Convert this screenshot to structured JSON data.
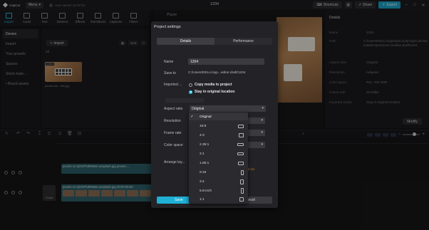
{
  "app": {
    "logo_text": "CapCut",
    "menu_label": "Menu",
    "autosave_text": "Auto saved: 21:07:51",
    "project_title": "1204",
    "shortcuts_label": "Shortcuts",
    "share_label": "Share",
    "export_label": "Export",
    "minimize_glyph": "–",
    "maximize_glyph": "□",
    "close_glyph": "✕"
  },
  "tools": [
    {
      "label": "Import",
      "icon": "import-icon"
    },
    {
      "label": "Audio",
      "icon": "audio-icon"
    },
    {
      "label": "Text",
      "icon": "text-icon"
    },
    {
      "label": "Stickers",
      "icon": "stickers-icon"
    },
    {
      "label": "Effects",
      "icon": "effects-icon"
    },
    {
      "label": "Transitions",
      "icon": "transitions-icon"
    },
    {
      "label": "Captions",
      "icon": "captions-icon"
    },
    {
      "label": "Filters",
      "icon": "filters-icon"
    }
  ],
  "left_nav": {
    "items": [
      "Device",
      "Import",
      "Your presets",
      "Spaces",
      "Stock mate...",
      "• Brand assets"
    ]
  },
  "media": {
    "import_label": "Import",
    "sort_label": "Sort",
    "all_label": "All",
    "added_badge": "Added",
    "thumb_name": "pexels-ckl... flat.jpg"
  },
  "player": {
    "title": "Player"
  },
  "details_panel": {
    "title": "Details",
    "rows": [
      {
        "key": "Name",
        "value": "1204"
      },
      {
        "key": "Path",
        "value": "C:/Users/DELL/AppData/Local/CapCut/User Data/Projects/com.lveditor.draft/1204"
      },
      {
        "key": "Aspect ratio",
        "value": "Original"
      },
      {
        "key": "Resolution",
        "value": "Adapted"
      },
      {
        "key": "Color space",
        "value": "Rec. 709 SDR"
      },
      {
        "key": "Frame rate",
        "value": "30.00fps"
      },
      {
        "key": "Imported media",
        "value": "Stay in original location"
      }
    ],
    "modify_label": "Modify"
  },
  "timeline": {
    "clip_a_label": "pexels-cs-QHOPhdR6Mw-unsplash.jpg  pexels-...",
    "clip_b_label": "pexels-cs-QHOPhdR6Mw-unsplash.jpg  00:00:05:00",
    "cover_label": "Cover"
  },
  "modal": {
    "title": "Project settings",
    "tab_details": "Details",
    "tab_performance": "Performance",
    "name_label": "Name",
    "name_value": "1204",
    "save_to_label": "Save to",
    "save_to_value": "C:/Users/DELL/App...editor.draft/1204",
    "imported_label": "Imported ...",
    "copy_option": "Copy media to project",
    "stay_option": "Stay in original location",
    "aspect_label": "Aspect ratio",
    "aspect_value": "Original",
    "resolution_label": "Resolution",
    "framerate_label": "Frame rate",
    "colorspace_label": "Color space",
    "arrange_label": "Arrange lay...",
    "notice_text": "ed on.",
    "save_label": "Save",
    "cancel_label": "Cancel"
  },
  "aspect_dropdown": {
    "selected": "Original",
    "options": [
      "Original",
      "16:9",
      "4:3",
      "2.35:1",
      "2:1",
      "1.85:1",
      "9:16",
      "3:4",
      "5.8-inch",
      "1:1"
    ]
  },
  "colors": {
    "accent": "#1fb0d6",
    "warning": "#c47a2e",
    "panel": "#1b1b1e"
  }
}
